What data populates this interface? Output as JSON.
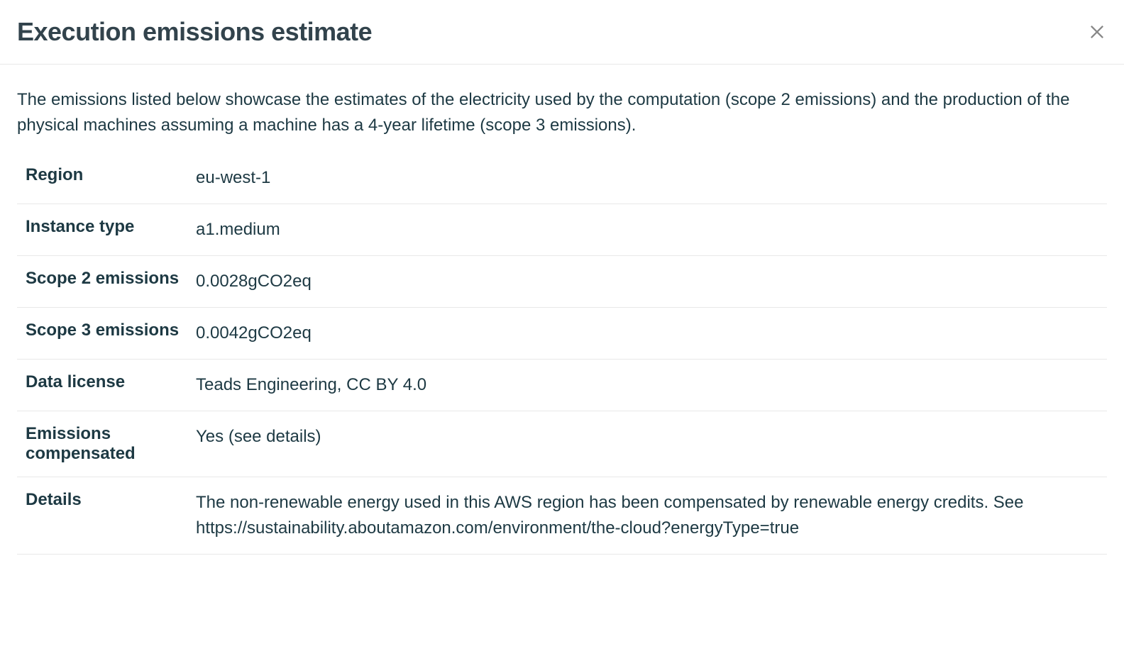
{
  "header": {
    "title": "Execution emissions estimate"
  },
  "description": "The emissions listed below showcase the estimates of the electricity used by the computation (scope 2 emissions) and the production of the physical machines assuming a machine has a 4-year lifetime (scope 3 emissions).",
  "rows": [
    {
      "label": "Region",
      "value": "eu-west-1"
    },
    {
      "label": "Instance type",
      "value": "a1.medium"
    },
    {
      "label": "Scope 2 emissions",
      "value": "0.0028gCO2eq"
    },
    {
      "label": "Scope 3 emissions",
      "value": "0.0042gCO2eq"
    },
    {
      "label": "Data license",
      "value": "Teads Engineering, CC BY 4.0"
    },
    {
      "label": "Emissions compensated",
      "value": "Yes (see details)"
    },
    {
      "label": "Details",
      "value": "The non-renewable energy used in this AWS region has been compensated by renewable energy credits. See https://sustainability.aboutamazon.com/environment/the-cloud?energyType=true"
    }
  ]
}
